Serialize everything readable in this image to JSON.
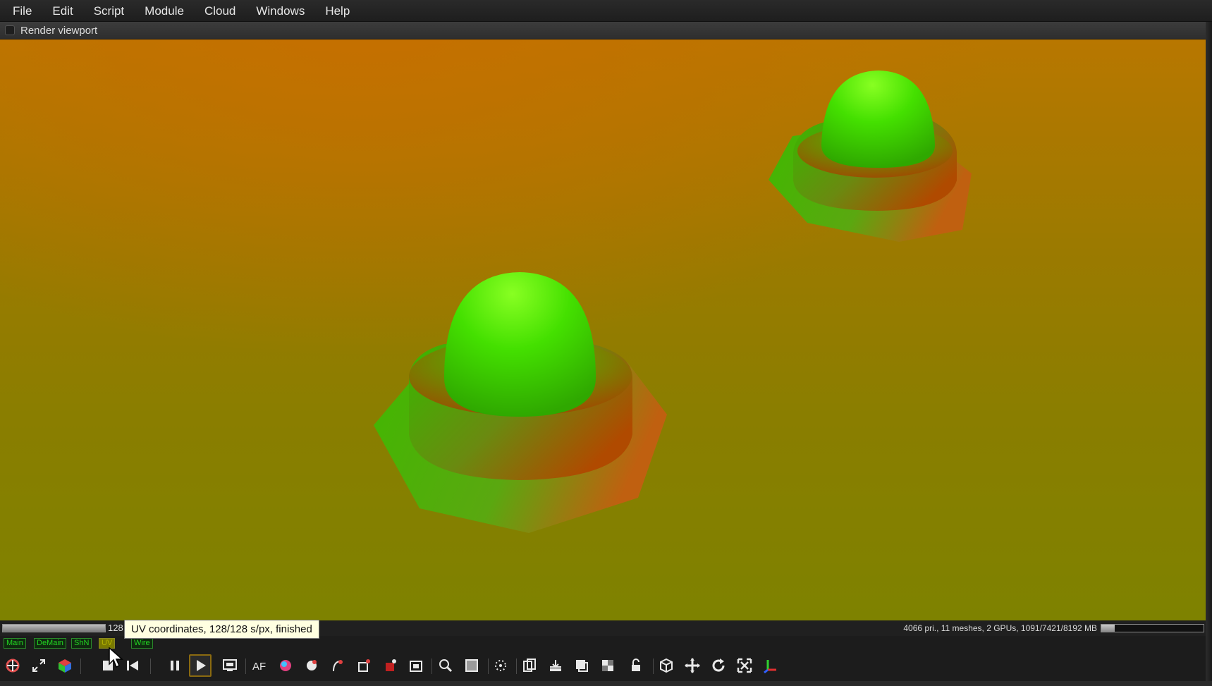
{
  "menu": [
    "File",
    "Edit",
    "Script",
    "Module",
    "Cloud",
    "Windows",
    "Help"
  ],
  "panel": {
    "title": "Render viewport"
  },
  "status": {
    "progress_fraction": 1.0,
    "progress_count": "128",
    "tooltip": "UV coordinates, 128/128 s/px, finished",
    "stats": "4066 pri., 11 meshes, 2 GPUs, 1091/7421/8192 MB",
    "memory_fraction": 0.13
  },
  "modes": [
    {
      "label": "Main",
      "active": false
    },
    {
      "label": "DeMain",
      "active": false
    },
    {
      "label": "ShN",
      "active": false
    },
    {
      "label": "UV",
      "active": true
    },
    {
      "label": "Wire",
      "active": false
    }
  ],
  "toolbar_icons": [
    "recenter-icon",
    "fit-view-icon",
    "cube-color-icon",
    "stop-icon",
    "rewind-icon",
    "pause-icon",
    "play-icon",
    "render-region-icon",
    "af-icon",
    "color-picker-icon",
    "material-picker-icon",
    "focus-picker-icon",
    "object-picker-icon",
    "camera-target-icon",
    "crop-icon",
    "zoom-icon",
    "region-icon",
    "lens-icon",
    "copy-icon",
    "save-icon",
    "clipboard-icon",
    "checker-icon",
    "lock-icon",
    "cube-view-icon",
    "move-icon",
    "rotate-icon",
    "scale-icon",
    "axis-icon"
  ],
  "colors": {
    "tooltip_bg": "#ffffe1",
    "mode_green": "#22d422",
    "mode_active": "#7a7a00",
    "viewport_top": "#b87700",
    "viewport_bottom": "#7e8200"
  }
}
